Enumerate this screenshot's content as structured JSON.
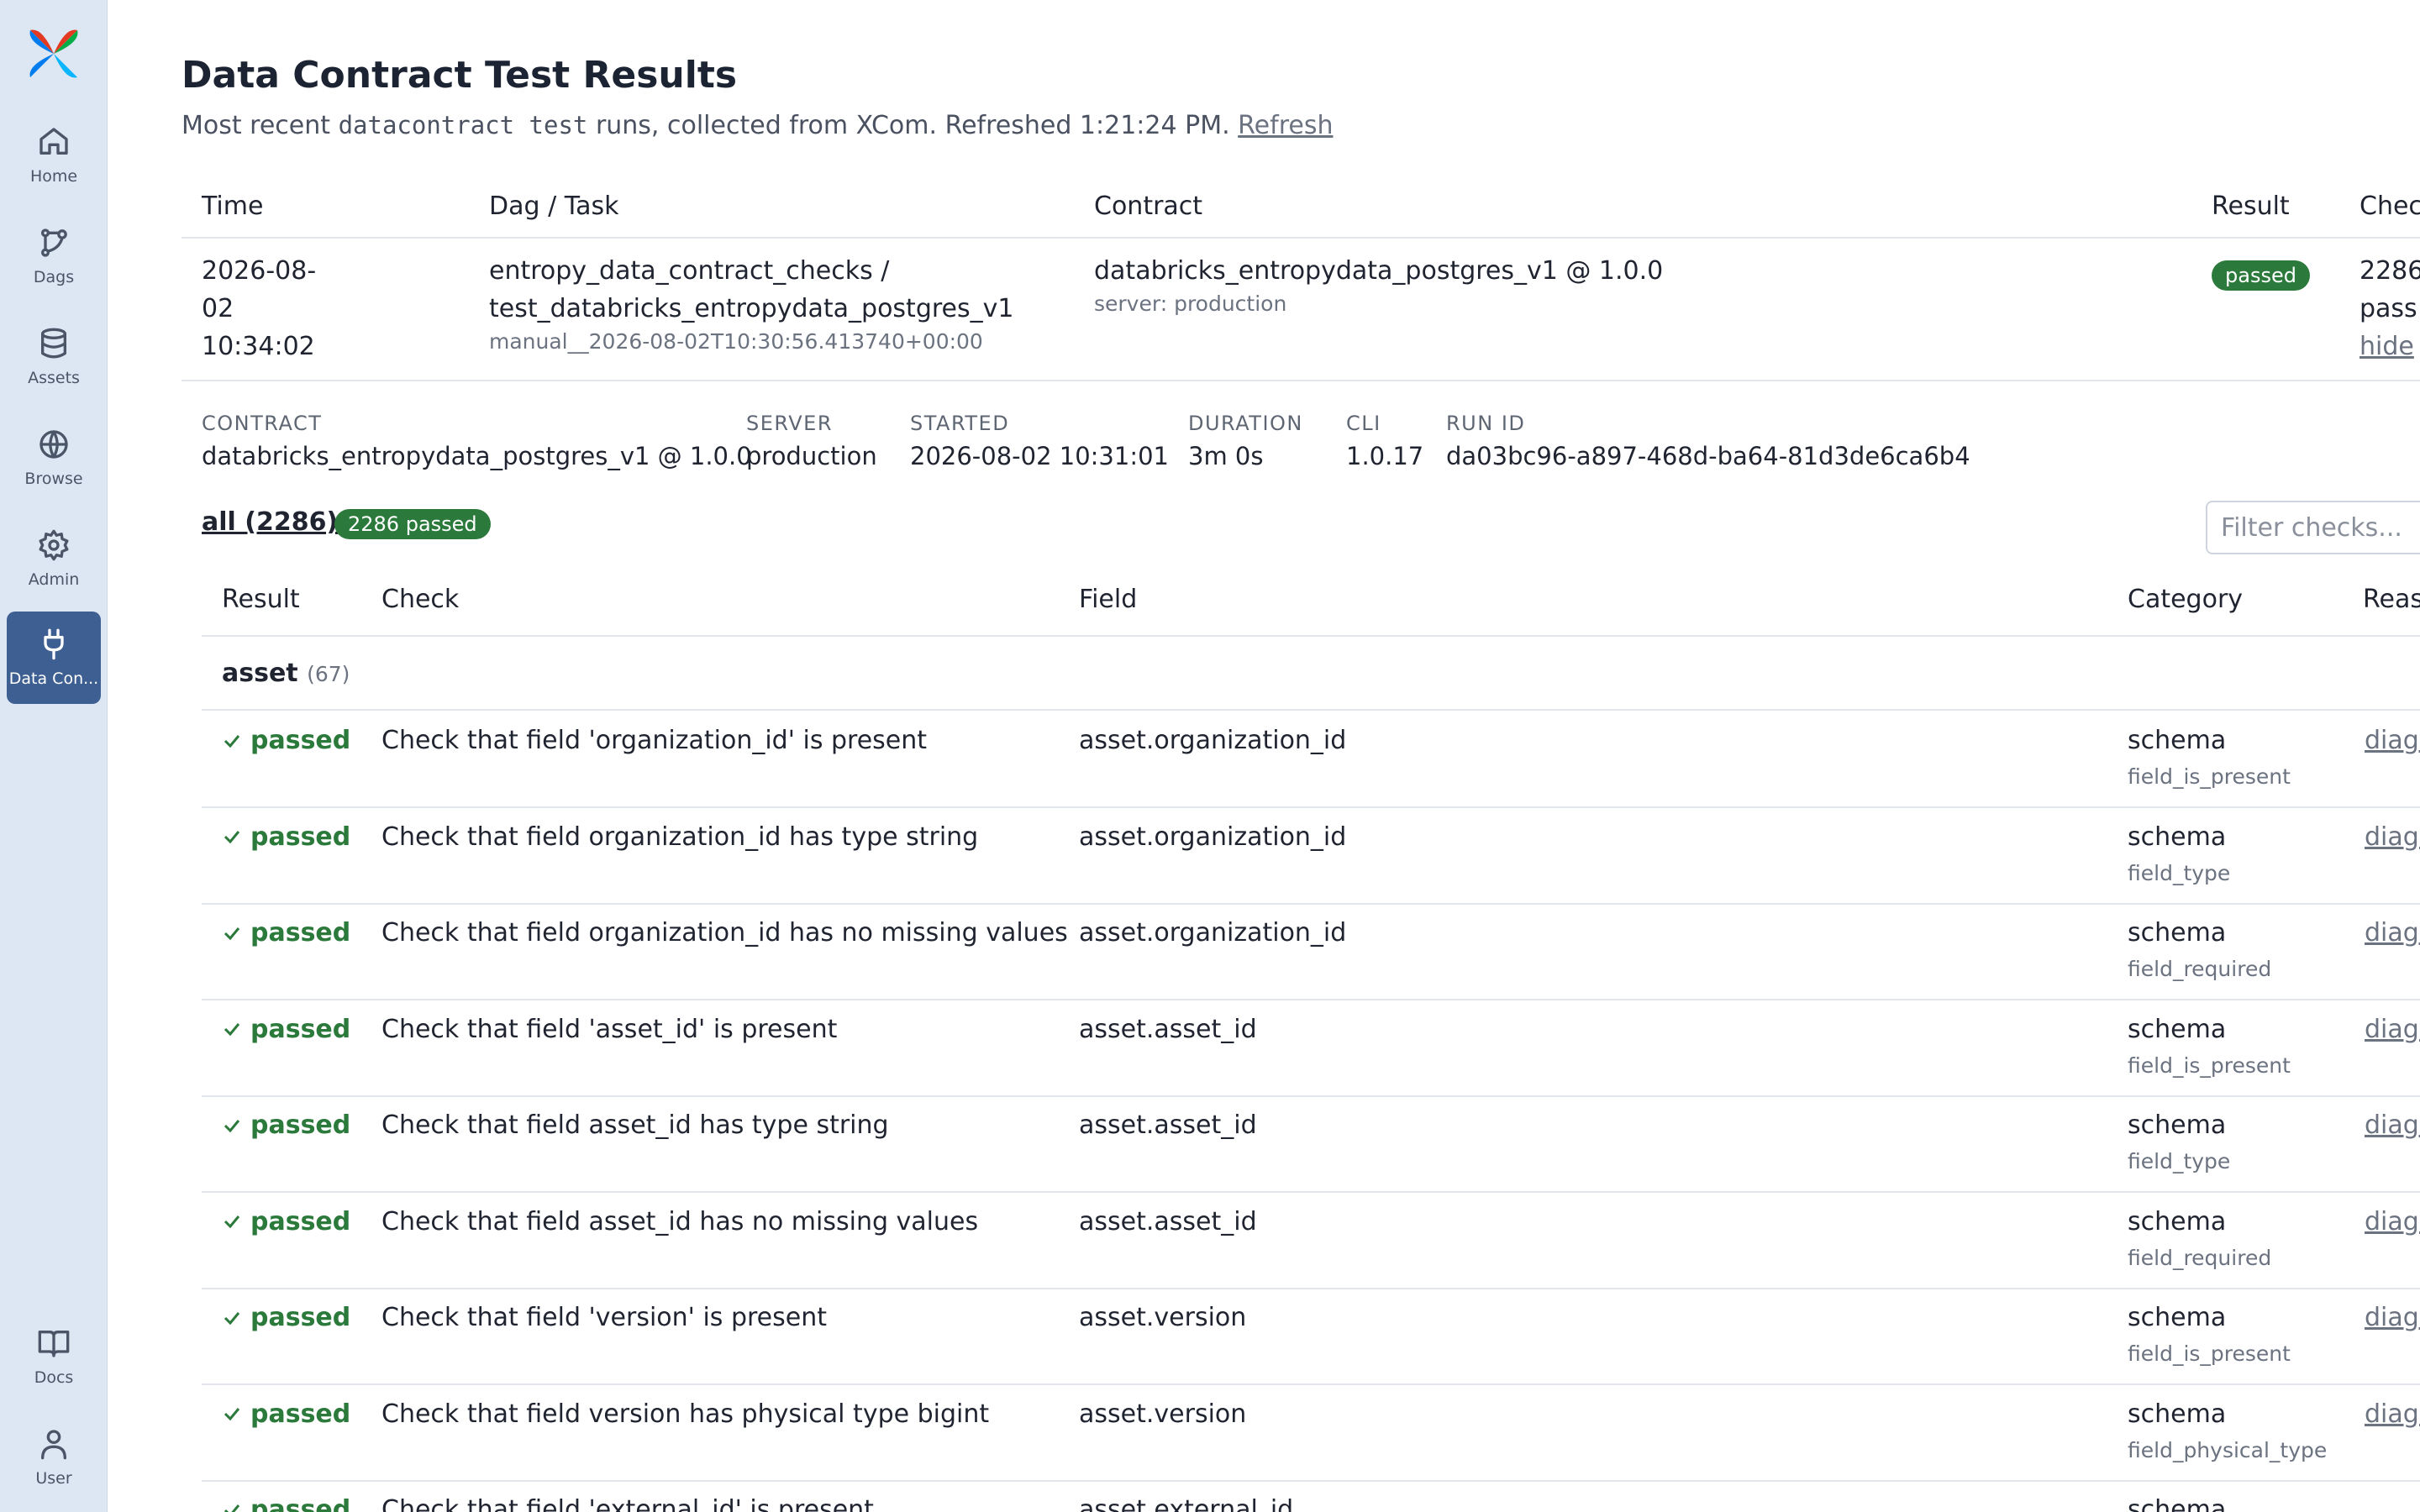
{
  "nav": {
    "items": [
      {
        "label": "Home",
        "icon": "home-icon"
      },
      {
        "label": "Dags",
        "icon": "dags-icon"
      },
      {
        "label": "Assets",
        "icon": "database-icon"
      },
      {
        "label": "Browse",
        "icon": "globe-icon"
      },
      {
        "label": "Admin",
        "icon": "gear-icon"
      },
      {
        "label": "Data Con...",
        "icon": "plug-icon",
        "active": true
      }
    ],
    "bottom": [
      {
        "label": "Docs",
        "icon": "book-icon"
      },
      {
        "label": "User",
        "icon": "user-icon"
      }
    ]
  },
  "header": {
    "title": "Data Contract Test Results",
    "subtitle_prefix": "Most recent",
    "subtitle_code": "datacontract test",
    "subtitle_suffix": "runs, collected from XCom. Refreshed 1:21:24 PM.",
    "refresh_label": "Refresh"
  },
  "runs": {
    "columns": [
      "Time",
      "Dag / Task",
      "Contract",
      "Result",
      "Chec"
    ],
    "row": {
      "time_line1": "2026-08-",
      "time_line2": "02",
      "time_line3": "10:34:02",
      "dag": "entropy_data_contract_checks /",
      "task": "test_databricks_entropydata_postgres_v1",
      "run_id": "manual__2026-08-02T10:30:56.413740+00:00",
      "contract": "databricks_entropydata_postgres_v1 @ 1.0.0",
      "server": "server: production",
      "result": "passed",
      "checks_line1": "2286",
      "checks_line2": "pass",
      "hide_label": "hide"
    }
  },
  "details": {
    "contract_key": "CONTRACT",
    "contract_val": "databricks_entropydata_postgres_v1 @ 1.0.0",
    "server_key": "SERVER",
    "server_val": "production",
    "started_key": "STARTED",
    "started_val": "2026-08-02 10:31:01",
    "duration_key": "DURATION",
    "duration_val": "3m 0s",
    "cli_key": "CLI",
    "cli_val": "1.0.17",
    "runid_key": "RUN ID",
    "runid_val": "da03bc96-a897-468d-ba64-81d3de6ca6b4"
  },
  "filter": {
    "all_label": "all (2286)",
    "passed_badge": "2286 passed",
    "placeholder": "Filter checks..."
  },
  "checks": {
    "columns": [
      "Result",
      "Check",
      "Field",
      "Category",
      "Reas"
    ],
    "group": {
      "name": "asset",
      "count": "(67)"
    },
    "rows": [
      {
        "result": "passed",
        "check": "Check that field 'organization_id' is present",
        "field": "asset.organization_id",
        "category": "schema",
        "subcategory": "field_is_present",
        "link": "diagn"
      },
      {
        "result": "passed",
        "check": "Check that field organization_id has type string",
        "field": "asset.organization_id",
        "category": "schema",
        "subcategory": "field_type",
        "link": "diagn"
      },
      {
        "result": "passed",
        "check": "Check that field organization_id has no missing values",
        "field": "asset.organization_id",
        "category": "schema",
        "subcategory": "field_required",
        "link": "diagn"
      },
      {
        "result": "passed",
        "check": "Check that field 'asset_id' is present",
        "field": "asset.asset_id",
        "category": "schema",
        "subcategory": "field_is_present",
        "link": "diagn"
      },
      {
        "result": "passed",
        "check": "Check that field asset_id has type string",
        "field": "asset.asset_id",
        "category": "schema",
        "subcategory": "field_type",
        "link": "diagn"
      },
      {
        "result": "passed",
        "check": "Check that field asset_id has no missing values",
        "field": "asset.asset_id",
        "category": "schema",
        "subcategory": "field_required",
        "link": "diagn"
      },
      {
        "result": "passed",
        "check": "Check that field 'version' is present",
        "field": "asset.version",
        "category": "schema",
        "subcategory": "field_is_present",
        "link": "diagn"
      },
      {
        "result": "passed",
        "check": "Check that field version has physical type bigint",
        "field": "asset.version",
        "category": "schema",
        "subcategory": "field_physical_type",
        "link": "diagn"
      },
      {
        "result": "passed",
        "check": "Check that field 'external_id' is present",
        "field": "asset.external_id",
        "category": "schema",
        "subcategory": "",
        "link": ""
      }
    ]
  },
  "colors": {
    "sidebar_bg": "#dde6f3",
    "active_nav": "#3d5f91",
    "success": "#2b7a3b"
  }
}
